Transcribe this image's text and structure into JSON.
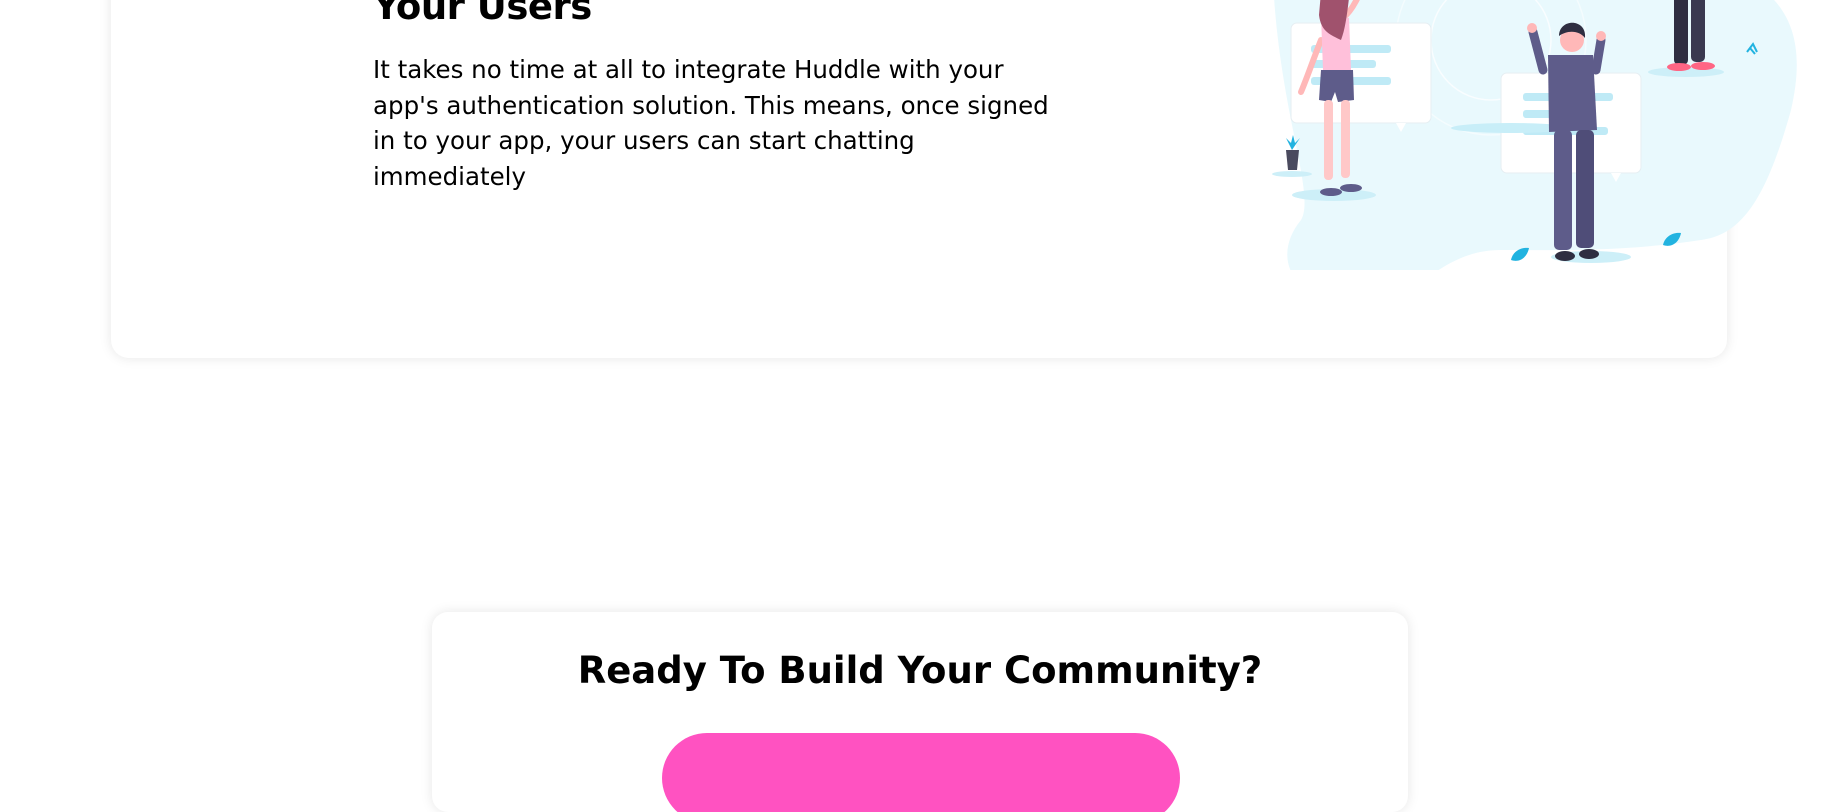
{
  "feature": {
    "title": "Your Users",
    "description": "It takes no time at all to integrate Huddle with your app's authentication solution. This means, once signed in to your app, your users can start chatting immediately"
  },
  "cta": {
    "title": "Ready To Build Your Community?",
    "button_label": ""
  },
  "illustration": {
    "icon": "users-chatting-illustration"
  },
  "colors": {
    "accent": "#ff52c1",
    "blob": "#e8f8fd",
    "suit": "#5e5c8a",
    "skin": "#ffb8b8",
    "leaf": "#22b3e0"
  }
}
